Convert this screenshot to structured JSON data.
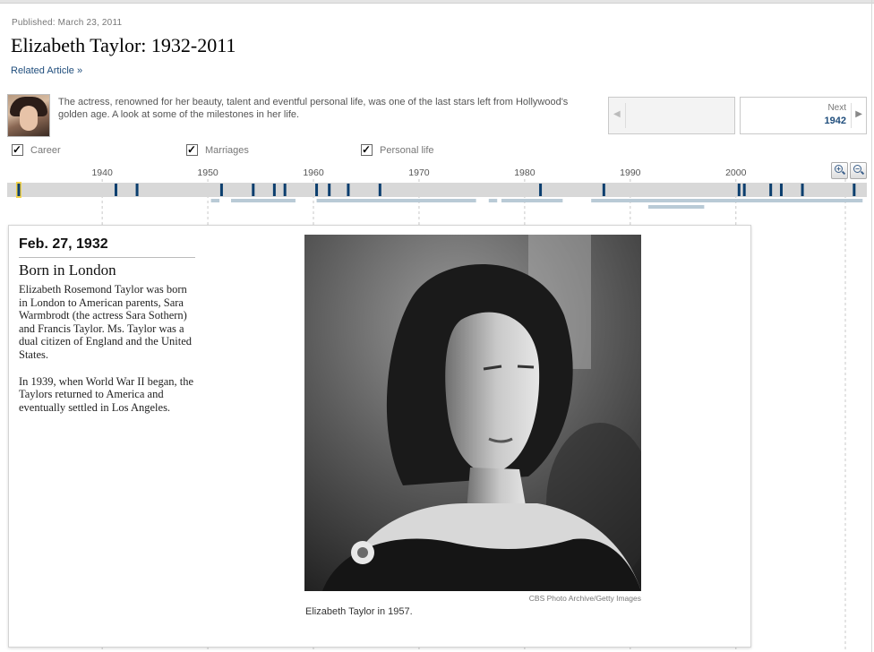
{
  "header": {
    "published": "Published: March 23, 2011",
    "title": "Elizabeth Taylor: 1932-2011",
    "related_link": "Related Article »"
  },
  "intro": {
    "thumbnail_icon": "portrait-thumbnail",
    "text": "The actress, renowned for her beauty, talent and eventful personal life, was one of the last stars left from Hollywood's golden age. A look at some of the milestones in her life."
  },
  "navigation": {
    "prev_arrow": "◀",
    "next_label": "Next",
    "next_year": "1942",
    "next_arrow": "▶"
  },
  "filters": [
    {
      "label": "Career",
      "checked": true
    },
    {
      "label": "Marriages",
      "checked": true
    },
    {
      "label": "Personal life",
      "checked": true
    }
  ],
  "zoom": {
    "in_icon": "zoom-in-icon",
    "out_icon": "zoom-out-icon"
  },
  "timeline": {
    "start_year": 1931,
    "end_year": 2012.4,
    "decade_labels": [
      "1940",
      "1950",
      "1960",
      "1970",
      "1980",
      "1990",
      "2000"
    ],
    "decade_values": [
      1940,
      1950,
      1960,
      1970,
      1980,
      1990,
      2000
    ],
    "selected_year": 1932.1,
    "events": [
      1932.1,
      1941.3,
      1943.3,
      1951.3,
      1954.3,
      1956.3,
      1957.3,
      1960.3,
      1961.5,
      1963.3,
      1966.3,
      1981.5,
      1987.5,
      2000.3,
      2000.8,
      2003.3,
      2004.3,
      2006.3,
      2011.2
    ],
    "color_marker": "#0b3e6e",
    "color_bar": "#d8d8d8",
    "color_spans": "#b9cad6",
    "color_selected": "#f2d24a",
    "spans_row1": [
      [
        1950.3,
        1951.1
      ],
      [
        1952.2,
        1958.3
      ],
      [
        1960.3,
        1975.4
      ],
      [
        1976.6,
        1977.4
      ],
      [
        1977.8,
        1983.6
      ],
      [
        1986.3,
        2012.0
      ]
    ],
    "spans_row2": [
      [
        1991.7,
        1997.0
      ]
    ]
  },
  "detail": {
    "date": "Feb. 27, 1932",
    "headline": "Born in London",
    "paragraphs": [
      "Elizabeth Rosemond Taylor was born in London to American parents, Sara Warmbrodt (the actress Sara Sothern) and Francis Taylor. Ms. Taylor was a dual citizen of England and the United States.",
      "In 1939, when World War II began, the Taylors returned to America and eventually settled in Los Angeles."
    ],
    "photo_credit": "CBS Photo Archive/Getty Images",
    "caption": "Elizabeth Taylor in 1957."
  }
}
